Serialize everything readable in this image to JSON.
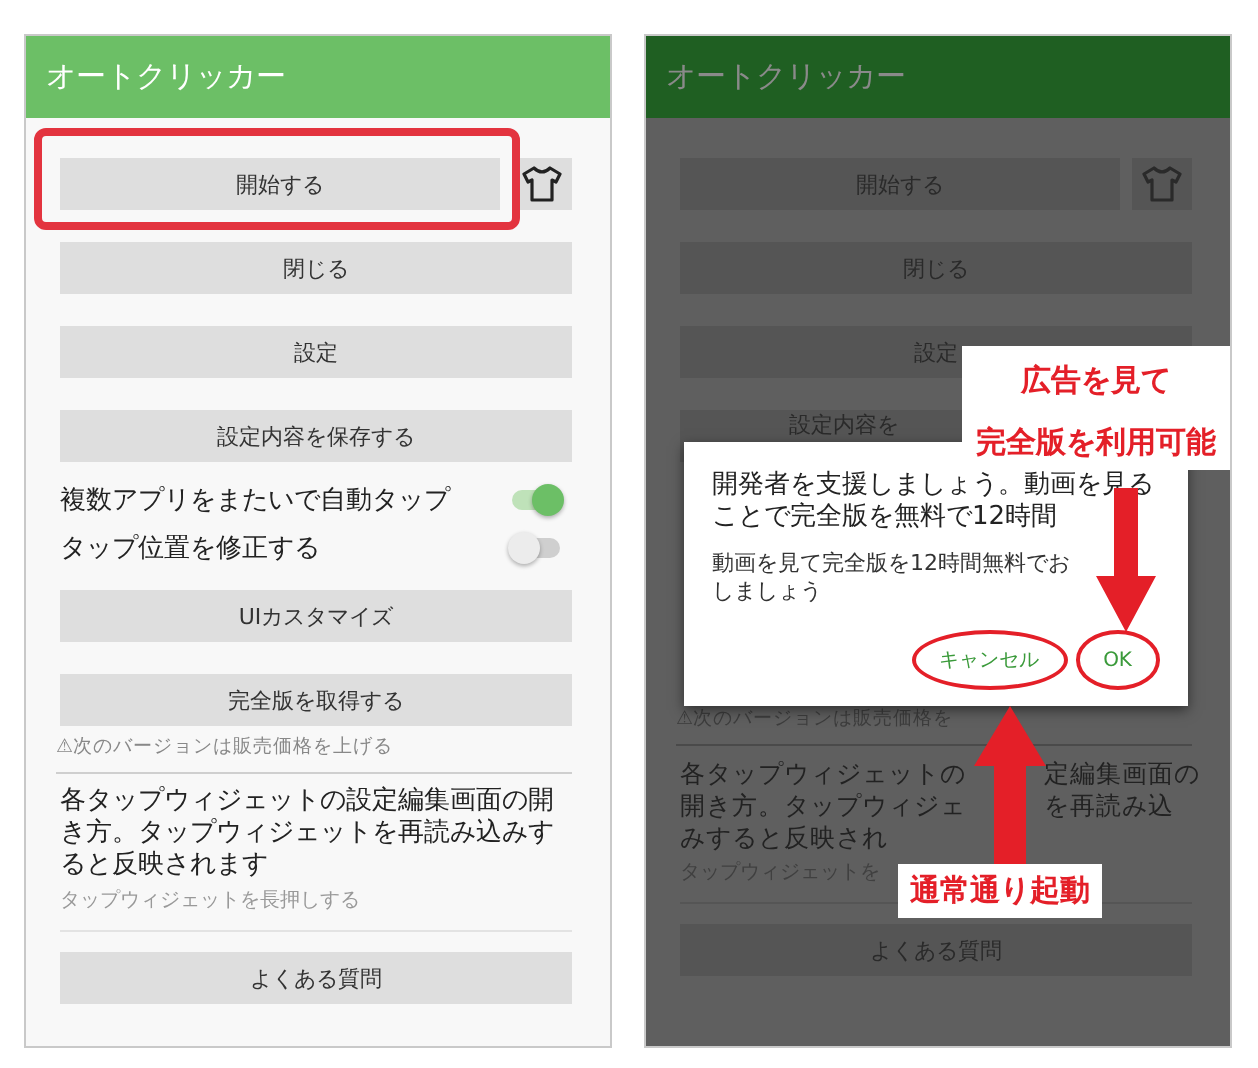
{
  "screens": [
    {
      "dimmed": false,
      "title": "オートクリッカー",
      "items": [
        {
          "kind": "button",
          "label": "開始する",
          "shirt": true,
          "highlighted": true
        },
        {
          "kind": "button",
          "label": "閉じる"
        },
        {
          "kind": "button",
          "label": "設定"
        },
        {
          "kind": "button",
          "label": "設定内容を保存する"
        },
        {
          "kind": "toggle",
          "label": "複数アプリをまたいで自動タップ",
          "on": true
        },
        {
          "kind": "toggle",
          "label": "タップ位置を修正する",
          "on": false
        },
        {
          "kind": "button",
          "label": "UIカスタマイズ"
        },
        {
          "kind": "button",
          "label": "完全版を取得する"
        },
        {
          "kind": "note",
          "text": "⚠次のバージョンは販売価格を上げる"
        },
        {
          "kind": "info",
          "title": "各タップウィジェットの設定編集画面の開き方。タップウィジェットを再読み込みすると反映されます",
          "subtitle": "タップウィジェットを長押しする"
        },
        {
          "kind": "button",
          "label": "よくある質問"
        }
      ]
    },
    {
      "dimmed": true,
      "title": "オートクリッカー",
      "items": [
        {
          "kind": "button",
          "label": "開始する",
          "shirt": true,
          "highlighted": false
        },
        {
          "kind": "button",
          "label": "閉じる"
        },
        {
          "kind": "button",
          "label": "設定"
        },
        {
          "kind": "partial_button",
          "label": "設定内容を"
        },
        {
          "kind": "dialog",
          "message": "開発者を支援しましょう。動画を見ることで完全版を無料で12時間",
          "detail": [
            "動画を見て完全版を12時間無料でお",
            "しましょう"
          ],
          "actions": [
            {
              "label": "キャンセル",
              "circled": true
            },
            {
              "label": "OK",
              "circled": true
            }
          ]
        },
        {
          "kind": "note",
          "text": "⚠次のバージョンは販売価格を"
        },
        {
          "kind": "split_info",
          "lines": [
            [
              "各タップウィジェットの",
              "定編集画面の"
            ],
            [
              "開き方。タップウィジェ",
              "を再読み込"
            ],
            [
              "みすると反映され"
            ]
          ],
          "subtitle": "タップウィジェットを"
        },
        {
          "kind": "button",
          "label": "よくある質問"
        }
      ],
      "ad_callout": {
        "lines": [
          "広告を見て",
          "完全版を利用可能"
        ]
      },
      "cancel_callout": {
        "lines": [
          "通常通り起動"
        ]
      }
    }
  ]
}
